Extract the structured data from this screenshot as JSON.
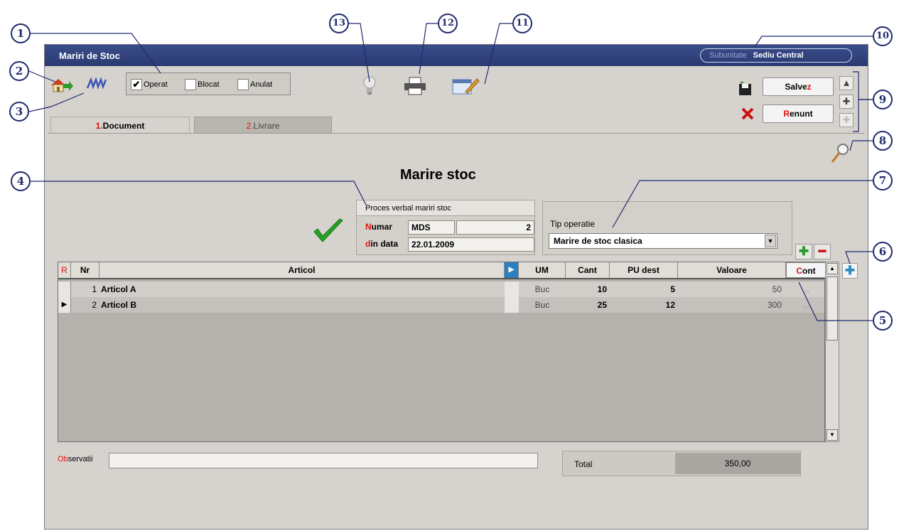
{
  "callouts": [
    "1",
    "2",
    "3",
    "4",
    "5",
    "6",
    "7",
    "8",
    "9",
    "10",
    "11",
    "12",
    "13"
  ],
  "window": {
    "title": "Mariri de Stoc",
    "subunit_label": "Subunitate",
    "subunit_value": "Sediu Central"
  },
  "status_checks": [
    {
      "label": "Operat",
      "checked": true
    },
    {
      "label": "Blocat",
      "checked": false
    },
    {
      "label": "Anulat",
      "checked": false
    }
  ],
  "buttons": {
    "save_hot": "z",
    "save_pre": "Salve",
    "cancel_hot": "R",
    "cancel_post": "enunt"
  },
  "tabs": [
    {
      "num": "1.",
      "label": "Document"
    },
    {
      "num": "2.",
      "label": "Livrare"
    }
  ],
  "page_title": "Marire stoc",
  "doc": {
    "header": "Proces verbal mariri stoc",
    "numar_hot": "N",
    "numar_rest": "umar",
    "data_hot": "d",
    "data_rest": "in data",
    "series": "MDS",
    "number": "2",
    "date": "22.01.2009"
  },
  "operation": {
    "label": "Tip operatie",
    "value": "Marire de stoc clasica"
  },
  "grid": {
    "marker": "R",
    "columns": {
      "nr": "Nr",
      "articol": "Articol",
      "um": "UM",
      "cant": "Cant",
      "pu": "PU dest",
      "valoare": "Valoare",
      "cont_hot": "C",
      "cont_rest": "ont"
    },
    "rows": [
      {
        "nr": "1",
        "articol": "Articol A",
        "um": "Buc",
        "cant": "10",
        "pu": "5",
        "valoare": "50",
        "cont": "..."
      },
      {
        "nr": "2",
        "articol": "Articol B",
        "um": "Buc",
        "cant": "25",
        "pu": "12",
        "valoare": "300",
        "cont": "..."
      }
    ]
  },
  "footer": {
    "obs_hot": "Ob",
    "obs_rest": "servatii",
    "total_label": "Total",
    "total_value": "350,00"
  }
}
